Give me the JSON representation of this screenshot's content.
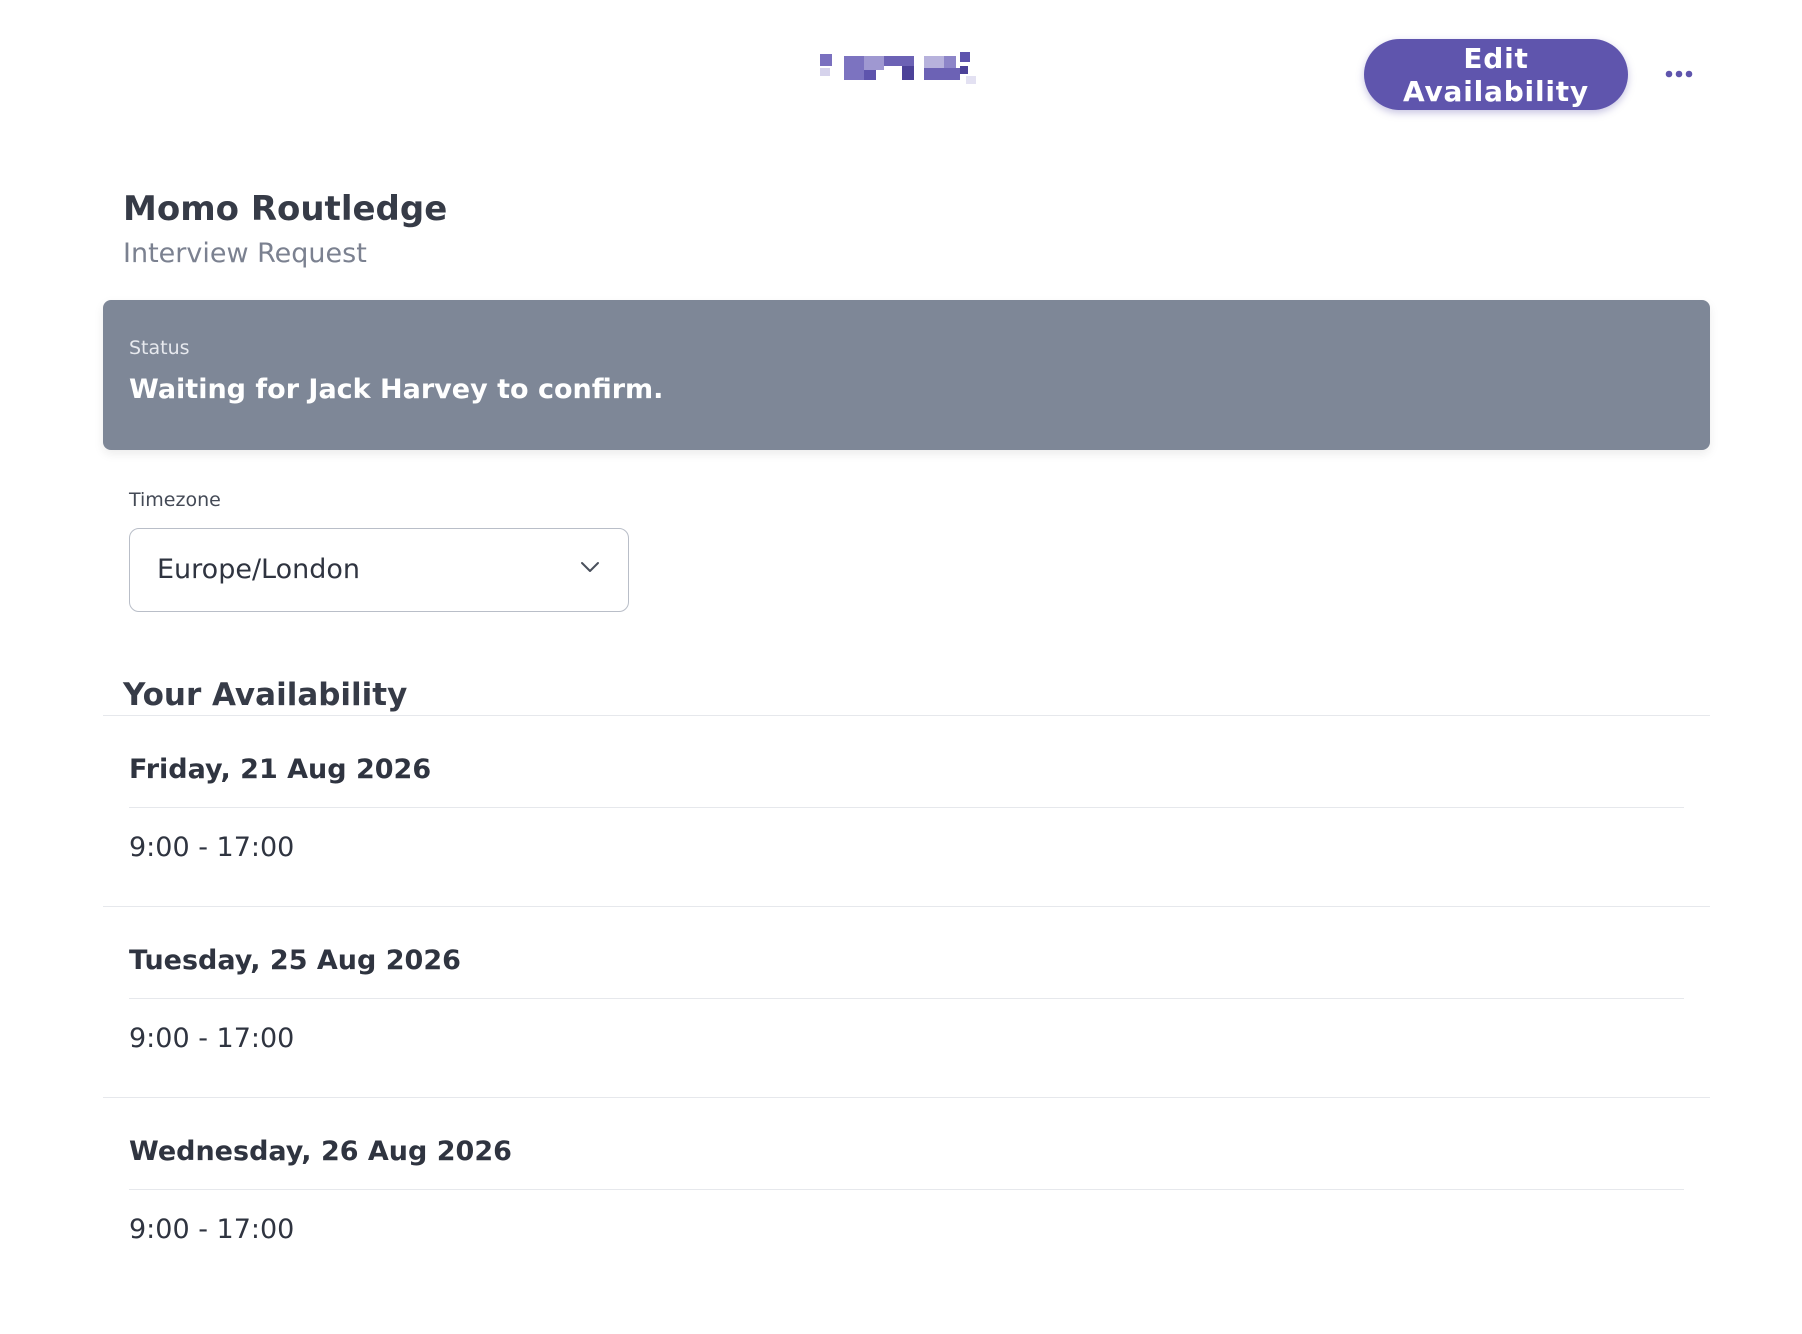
{
  "header": {
    "edit_button_label": "Edit Availability",
    "more_icon": "more-horizontal-icon"
  },
  "request": {
    "name": "Momo Routledge",
    "type": "Interview Request"
  },
  "status": {
    "label": "Status",
    "text": "Waiting for Jack Harvey to confirm."
  },
  "timezone": {
    "label": "Timezone",
    "value": "Europe/London",
    "icon": "chevron-down-icon"
  },
  "availability": {
    "title": "Your Availability",
    "days": [
      {
        "date": "Friday, 21 Aug 2026",
        "time": "9:00 - 17:00"
      },
      {
        "date": "Tuesday, 25 Aug 2026",
        "time": "9:00 - 17:00"
      },
      {
        "date": "Wednesday, 26 Aug 2026",
        "time": "9:00 - 17:00"
      }
    ]
  },
  "colors": {
    "accent": "#5f55ad",
    "status_banner": "#7e8797",
    "logo_primary": "#6c62b5",
    "logo_light": "#b7b2dc"
  }
}
